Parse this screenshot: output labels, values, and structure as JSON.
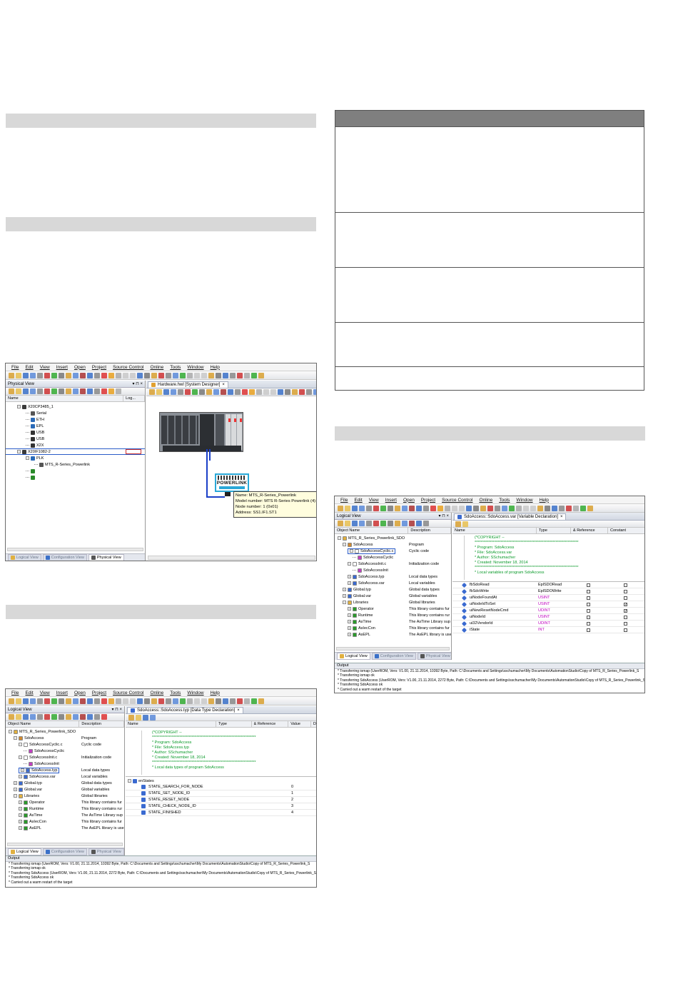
{
  "common": {
    "menus": [
      "File",
      "Edit",
      "View",
      "Insert",
      "Open",
      "Project",
      "Source Control",
      "Online",
      "Tools",
      "Window",
      "Help"
    ]
  },
  "shot1": {
    "left_pane_title": "Physical View",
    "col_name": "Name",
    "col_log": "Log...",
    "tree": [
      {
        "label": "X20CP3485_1",
        "indent": 1,
        "expand": "−",
        "icon": "#3a3a3a"
      },
      {
        "label": "Serial",
        "indent": 2,
        "expand": "",
        "icon": "#555"
      },
      {
        "label": "ETH",
        "indent": 2,
        "expand": "",
        "icon": "#2a6ab8"
      },
      {
        "label": "EPL",
        "indent": 2,
        "expand": "",
        "icon": "#2a6ab8"
      },
      {
        "label": "USB",
        "indent": 2,
        "expand": "",
        "icon": "#333"
      },
      {
        "label": "USB",
        "indent": 2,
        "expand": "",
        "icon": "#333"
      },
      {
        "label": "X2X",
        "indent": 2,
        "expand": "",
        "icon": "#333"
      },
      {
        "label": "X20IF1082-2",
        "indent": 1,
        "expand": "−",
        "icon": "#3a3a3a"
      },
      {
        "label": "PLK",
        "indent": 2,
        "expand": "−",
        "icon": "#2a6ab8"
      },
      {
        "label": "MTS_R-Series_Powerlink",
        "indent": 3,
        "expand": "",
        "icon": "#555"
      },
      {
        "label": "",
        "indent": 2,
        "expand": "",
        "icon": "#2a8a2a"
      },
      {
        "label": "",
        "indent": 2,
        "expand": "",
        "icon": "#2a8a2a"
      }
    ],
    "tabs": [
      "Logical View",
      "Configuration View",
      "Physical View"
    ],
    "doc_tab": "Hardware.hwl [System Designer]",
    "powerlink_label": "POWERLINK",
    "tooltip": [
      "Name: MTS_R-Series_Powerlink",
      "Model number: MTS R-Series Powerlink (4)",
      "Node number: 1 (0x01)",
      "Address: SS1.IF1.ST1"
    ]
  },
  "shot2": {
    "left_pane_title": "Logical View",
    "col_name": "Object Name",
    "col_desc": "Description",
    "tree": [
      {
        "label": "MTS_R_Series_Powerlink_SDO",
        "desc": "",
        "indent": 1,
        "expand": "−",
        "icon": "#e0b040"
      },
      {
        "label": "SdoAccess",
        "desc": "Program",
        "indent": 2,
        "expand": "−",
        "icon": "#d08a30"
      },
      {
        "label": "SdoAccessCyclic.c",
        "desc": "Cyclic code",
        "indent": 3,
        "expand": "−",
        "icon": "#ffffff"
      },
      {
        "label": "SdoAccessCyclic",
        "desc": "",
        "indent": 4,
        "expand": "",
        "icon": "#c040c0"
      },
      {
        "label": "SdoAccessInit.c",
        "desc": "Initialization code",
        "indent": 3,
        "expand": "−",
        "icon": "#ffffff"
      },
      {
        "label": "SdoAccessInit",
        "desc": "",
        "indent": 4,
        "expand": "",
        "icon": "#c040c0"
      },
      {
        "label": "SdoAccess.typ",
        "desc": "Local data types",
        "indent": 3,
        "expand": "+",
        "icon": "#3a6ad0",
        "sel": true
      },
      {
        "label": "SdoAccess.var",
        "desc": "Local variables",
        "indent": 3,
        "expand": "+",
        "icon": "#3a6ad0"
      },
      {
        "label": "Global.typ",
        "desc": "Global data types",
        "indent": 2,
        "expand": "+",
        "icon": "#3a6ad0"
      },
      {
        "label": "Global.var",
        "desc": "Global variables",
        "indent": 2,
        "expand": "+",
        "icon": "#3a6ad0"
      },
      {
        "label": "Libraries",
        "desc": "Global libraries",
        "indent": 2,
        "expand": "−",
        "icon": "#e0b040"
      },
      {
        "label": "Operator",
        "desc": "This library contains fur",
        "indent": 3,
        "expand": "+",
        "icon": "#2a9a2a"
      },
      {
        "label": "Runtime",
        "desc": "This library contains rur",
        "indent": 3,
        "expand": "+",
        "icon": "#2a9a2a"
      },
      {
        "label": "AsTime",
        "desc": "The AsTime Library sup",
        "indent": 3,
        "expand": "+",
        "icon": "#2a9a2a"
      },
      {
        "label": "AsIecCon",
        "desc": "This library contains fur",
        "indent": 3,
        "expand": "+",
        "icon": "#2a9a2a"
      },
      {
        "label": "AsEPL",
        "desc": "The AsEPL library is use",
        "indent": 3,
        "expand": "+",
        "icon": "#2a9a2a"
      }
    ],
    "tabs": [
      "Logical View",
      "Configuration View",
      "Physical View"
    ],
    "doc_tab": "SdoAccess::SdoAccess.typ [Data Type Declaration]",
    "cols": [
      "Name",
      "Type",
      "& Reference",
      "Value",
      "De"
    ],
    "comment": [
      "(*COPYRIGHT --",
      "********************************************************************",
      "* Program: SdoAccess",
      "* File: SdoAccess.typ",
      "* Author: SSchumacher",
      "* Created: November 18, 2014",
      "********************************************************************",
      "* Local data types of program SdoAccess"
    ],
    "enum_name": "enStates",
    "enum_rows": [
      {
        "name": "STATE_SEARCH_FOR_NODE",
        "value": "0"
      },
      {
        "name": "STATE_SET_NODE_ID",
        "value": "1"
      },
      {
        "name": "STATE_RESET_NODE",
        "value": "2"
      },
      {
        "name": "STATE_CHECK_NODE_ID",
        "value": "3"
      },
      {
        "name": "STATE_FINISHED",
        "value": "4"
      }
    ],
    "output_title": "Output",
    "output": [
      "* Transferring iomap (UserROM, Vers: V1.00, 21.11.2014, 10392 Byte, Path: C:\\Documents and Settings\\sschumacher\\My Documents\\AutomationStudio\\Copy of MTS_R_Series_Powerlink_S",
      "* Transferring iomap ok",
      "* Transferring SdoAccess (UserROM, Vers: V1.00, 21.11.2014, 2272 Byte, Path: C:\\Documents and Settings\\sschumacher\\My Documents\\AutomationStudio\\Copy of MTS_R_Series_Powerlink_S",
      "* Transferring SdoAccess ok",
      "* Carried out a warm restart of the target"
    ]
  },
  "shot3": {
    "left_pane_title": "Logical View",
    "col_name": "Object Name",
    "col_desc": "Description",
    "tree": [
      {
        "label": "MTS_R_Series_Powerlink_SDO",
        "desc": "",
        "indent": 1,
        "expand": "−",
        "icon": "#e0b040"
      },
      {
        "label": "SdoAccess",
        "desc": "Program",
        "indent": 2,
        "expand": "−",
        "icon": "#d08a30"
      },
      {
        "label": "SdoAccessCyclic.c",
        "desc": "Cyclic code",
        "indent": 3,
        "expand": "−",
        "icon": "#ffffff",
        "sel": true
      },
      {
        "label": "SdoAccessCyclic",
        "desc": "",
        "indent": 4,
        "expand": "",
        "icon": "#c040c0"
      },
      {
        "label": "SdoAccessInit.c",
        "desc": "Initialization code",
        "indent": 3,
        "expand": "−",
        "icon": "#ffffff"
      },
      {
        "label": "SdoAccessInit",
        "desc": "",
        "indent": 4,
        "expand": "",
        "icon": "#c040c0"
      },
      {
        "label": "SdoAccess.typ",
        "desc": "Local data types",
        "indent": 3,
        "expand": "+",
        "icon": "#3a6ad0"
      },
      {
        "label": "SdoAccess.var",
        "desc": "Local variables",
        "indent": 3,
        "expand": "+",
        "icon": "#3a6ad0"
      },
      {
        "label": "Global.typ",
        "desc": "Global data types",
        "indent": 2,
        "expand": "+",
        "icon": "#3a6ad0"
      },
      {
        "label": "Global.var",
        "desc": "Global variables",
        "indent": 2,
        "expand": "+",
        "icon": "#3a6ad0"
      },
      {
        "label": "Libraries",
        "desc": "Global libraries",
        "indent": 2,
        "expand": "−",
        "icon": "#e0b040"
      },
      {
        "label": "Operator",
        "desc": "This library contains fur",
        "indent": 3,
        "expand": "+",
        "icon": "#2a9a2a"
      },
      {
        "label": "Runtime",
        "desc": "This library contains rur",
        "indent": 3,
        "expand": "+",
        "icon": "#2a9a2a"
      },
      {
        "label": "AsTime",
        "desc": "The AsTime Library sup",
        "indent": 3,
        "expand": "+",
        "icon": "#2a9a2a"
      },
      {
        "label": "AsIecCon",
        "desc": "This library contains fur",
        "indent": 3,
        "expand": "+",
        "icon": "#2a9a2a"
      },
      {
        "label": "AsEPL",
        "desc": "The AsEPL library is use",
        "indent": 3,
        "expand": "+",
        "icon": "#2a9a2a"
      }
    ],
    "tabs": [
      "Logical View",
      "Configuration View",
      "Physical View"
    ],
    "doc_tab": "SdoAccess::SdoAccess.var [Variable Declaration]",
    "cols": [
      "Name",
      "Type",
      "& Reference",
      "Constant"
    ],
    "comment": [
      "(*COPYRIGHT --",
      "********************************************************************",
      "* Program: SdoAccess",
      "* File: SdoAccess.var",
      "* Author: SSchumacher",
      "* Created: November 18, 2014",
      "********************************************************************",
      "* Local variables of program SdoAccess"
    ],
    "vars": [
      {
        "name": "fbSdoRead",
        "type": "EplSDORead",
        "ref": false,
        "const": false,
        "typecolor": "#000000"
      },
      {
        "name": "fbSdoWrite",
        "type": "EplSDOWrite",
        "ref": false,
        "const": false,
        "typecolor": "#000000"
      },
      {
        "name": "uiNodeFoundAt",
        "type": "USINT",
        "ref": false,
        "const": false,
        "typecolor": "#c000c0"
      },
      {
        "name": "uiNodeIdToSet",
        "type": "USINT",
        "ref": false,
        "const": true,
        "typecolor": "#c000c0"
      },
      {
        "name": "uiNewResetNodeCmd",
        "type": "UDINT",
        "ref": false,
        "const": true,
        "typecolor": "#c000c0"
      },
      {
        "name": "uiNodeId",
        "type": "USINT",
        "ref": false,
        "const": false,
        "typecolor": "#c000c0"
      },
      {
        "name": "ui32VendorId",
        "type": "UDINT",
        "ref": false,
        "const": false,
        "typecolor": "#c000c0"
      },
      {
        "name": "iState",
        "type": "INT",
        "ref": false,
        "const": false,
        "typecolor": "#c000c0"
      }
    ],
    "output_title": "Output",
    "output": [
      "* Transferring iomap (UserROM, Vers: V1.00, 21.11.2014, 10392 Byte, Path: C:\\Documents and Settings\\sschumacher\\My Documents\\AutomationStudio\\Copy of MTS_R_Series_Powerlink_S",
      "* Transferring iomap ok",
      "* Transferring SdoAccess (UserROM, Vers: V1.00, 21.11.2014, 2272 Byte, Path: C:\\Documents and Settings\\sschumacher\\My Documents\\AutomationStudio\\Copy of MTS_R_Series_Powerlink_S",
      "* Transferring SdoAccess ok",
      "* Carried out a warm restart of the target"
    ]
  }
}
